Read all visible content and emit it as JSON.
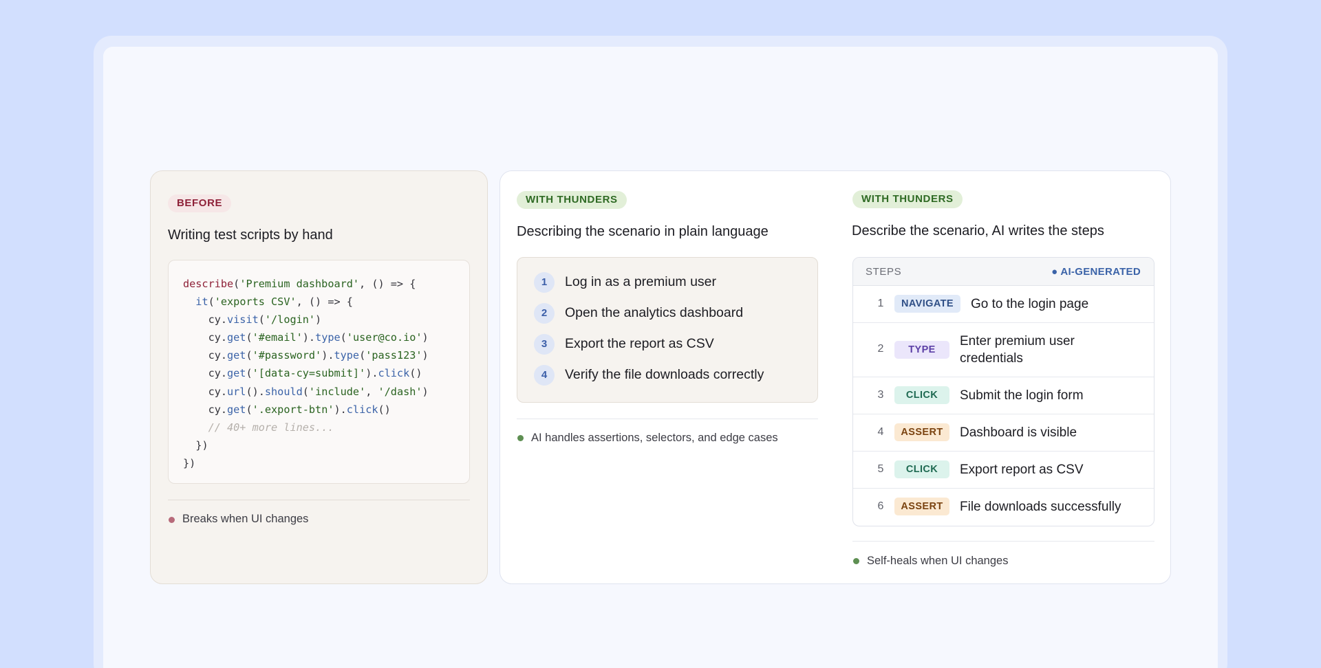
{
  "before": {
    "badge": "BEFORE",
    "title": "Writing test scripts by hand",
    "footnote": "Breaks when UI changes",
    "code_lines": [
      {
        "indent": 0,
        "tokens": [
          {
            "t": "describe",
            "c": "fn"
          },
          {
            "t": "(",
            "c": "p"
          },
          {
            "t": "'Premium dashboard'",
            "c": "str"
          },
          {
            "t": ", () => {",
            "c": "p"
          }
        ]
      },
      {
        "indent": 1,
        "tokens": [
          {
            "t": "it",
            "c": "meth"
          },
          {
            "t": "(",
            "c": "p"
          },
          {
            "t": "'exports CSV'",
            "c": "str"
          },
          {
            "t": ", () => {",
            "c": "p"
          }
        ]
      },
      {
        "indent": 2,
        "tokens": [
          {
            "t": "cy.",
            "c": "p"
          },
          {
            "t": "visit",
            "c": "meth"
          },
          {
            "t": "(",
            "c": "p"
          },
          {
            "t": "'/login'",
            "c": "str"
          },
          {
            "t": ")",
            "c": "p"
          }
        ]
      },
      {
        "indent": 2,
        "tokens": [
          {
            "t": "cy.",
            "c": "p"
          },
          {
            "t": "get",
            "c": "meth"
          },
          {
            "t": "(",
            "c": "p"
          },
          {
            "t": "'#email'",
            "c": "str"
          },
          {
            "t": ").",
            "c": "p"
          },
          {
            "t": "type",
            "c": "meth"
          },
          {
            "t": "(",
            "c": "p"
          },
          {
            "t": "'user@co.io'",
            "c": "str"
          },
          {
            "t": ")",
            "c": "p"
          }
        ]
      },
      {
        "indent": 2,
        "tokens": [
          {
            "t": "cy.",
            "c": "p"
          },
          {
            "t": "get",
            "c": "meth"
          },
          {
            "t": "(",
            "c": "p"
          },
          {
            "t": "'#password'",
            "c": "str"
          },
          {
            "t": ").",
            "c": "p"
          },
          {
            "t": "type",
            "c": "meth"
          },
          {
            "t": "(",
            "c": "p"
          },
          {
            "t": "'pass123'",
            "c": "str"
          },
          {
            "t": ")",
            "c": "p"
          }
        ]
      },
      {
        "indent": 2,
        "tokens": [
          {
            "t": "cy.",
            "c": "p"
          },
          {
            "t": "get",
            "c": "meth"
          },
          {
            "t": "(",
            "c": "p"
          },
          {
            "t": "'[data-cy=submit]'",
            "c": "str"
          },
          {
            "t": ").",
            "c": "p"
          },
          {
            "t": "click",
            "c": "meth"
          },
          {
            "t": "()",
            "c": "p"
          }
        ]
      },
      {
        "indent": 2,
        "tokens": [
          {
            "t": "cy.",
            "c": "p"
          },
          {
            "t": "url",
            "c": "meth"
          },
          {
            "t": "().",
            "c": "p"
          },
          {
            "t": "should",
            "c": "meth"
          },
          {
            "t": "(",
            "c": "p"
          },
          {
            "t": "'include'",
            "c": "str"
          },
          {
            "t": ", ",
            "c": "p"
          },
          {
            "t": "'/dash'",
            "c": "str"
          },
          {
            "t": ")",
            "c": "p"
          }
        ]
      },
      {
        "indent": 2,
        "tokens": [
          {
            "t": "cy.",
            "c": "p"
          },
          {
            "t": "get",
            "c": "meth"
          },
          {
            "t": "(",
            "c": "p"
          },
          {
            "t": "'.export-btn'",
            "c": "str"
          },
          {
            "t": ").",
            "c": "p"
          },
          {
            "t": "click",
            "c": "meth"
          },
          {
            "t": "()",
            "c": "p"
          }
        ]
      },
      {
        "indent": 2,
        "tokens": [
          {
            "t": "// 40+ more lines...",
            "c": "cmt"
          }
        ]
      },
      {
        "indent": 1,
        "tokens": [
          {
            "t": "})",
            "c": "p"
          }
        ]
      },
      {
        "indent": 0,
        "tokens": [
          {
            "t": "})",
            "c": "p"
          }
        ]
      }
    ]
  },
  "plain": {
    "badge": "WITH THUNDERS",
    "title": "Describing the scenario in plain language",
    "items": [
      {
        "num": "1",
        "text": "Log in as a premium user"
      },
      {
        "num": "2",
        "text": "Open the analytics dashboard"
      },
      {
        "num": "3",
        "text": "Export the report as CSV"
      },
      {
        "num": "4",
        "text": "Verify the file downloads correctly"
      }
    ],
    "footnote": "AI handles assertions, selectors, and edge cases"
  },
  "ai": {
    "badge": "WITH THUNDERS",
    "title": "Describe the scenario, AI writes the steps",
    "steps_label": "STEPS",
    "ai_generated_label": "● AI-GENERATED",
    "steps": [
      {
        "num": "1",
        "action": "NAVIGATE",
        "kind": "navigate",
        "text": "Go to the login page"
      },
      {
        "num": "2",
        "action": "TYPE",
        "kind": "type",
        "text": "Enter premium user credentials"
      },
      {
        "num": "3",
        "action": "CLICK",
        "kind": "click",
        "text": "Submit the login form"
      },
      {
        "num": "4",
        "action": "ASSERT",
        "kind": "assert",
        "text": "Dashboard is visible"
      },
      {
        "num": "5",
        "action": "CLICK",
        "kind": "click",
        "text": "Export report as CSV"
      },
      {
        "num": "6",
        "action": "ASSERT",
        "kind": "assert",
        "text": "File downloads successfully"
      }
    ],
    "footnote": "Self-heals when UI changes"
  },
  "colors": {
    "background": "#d2dffe",
    "before_accent": "#8e2138",
    "with_accent": "#2f6a24",
    "ai_accent": "#3b63a8",
    "dot_red": "#b76a7a",
    "dot_green": "#5e8f52"
  }
}
